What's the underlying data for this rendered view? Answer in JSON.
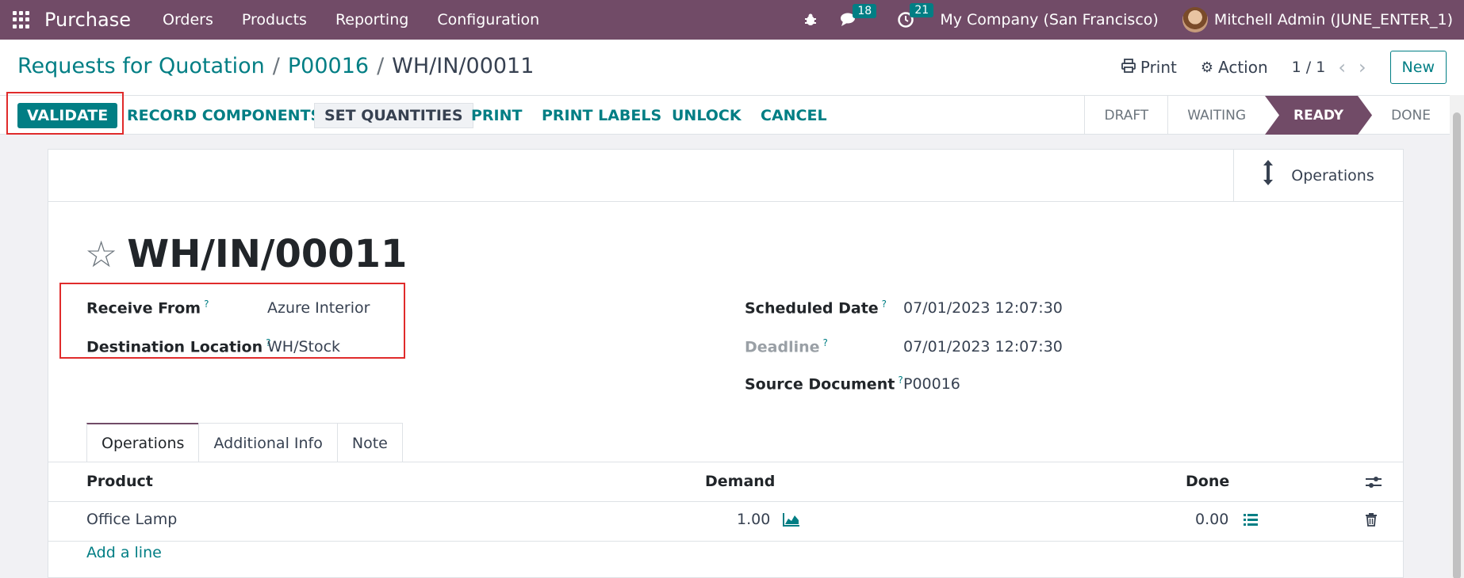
{
  "navbar": {
    "app_name": "Purchase",
    "menu": [
      "Orders",
      "Products",
      "Reporting",
      "Configuration"
    ],
    "messages_count": "18",
    "activities_count": "21",
    "company": "My Company (San Francisco)",
    "user": "Mitchell Admin (JUNE_ENTER_1)"
  },
  "breadcrumb": {
    "root": "Requests for Quotation",
    "parent": "P00016",
    "current": "WH/IN/00011",
    "sep": "/"
  },
  "control": {
    "print_label": "Print",
    "action_label": "Action",
    "pager": "1 / 1",
    "new_label": "New"
  },
  "statusbar": {
    "buttons": [
      "VALIDATE",
      "RECORD COMPONENTS",
      "SET QUANTITIES",
      "PRINT",
      "PRINT LABELS",
      "UNLOCK",
      "CANCEL"
    ],
    "stages": [
      "DRAFT",
      "WAITING",
      "READY",
      "DONE"
    ],
    "active_stage": "READY"
  },
  "form": {
    "smart_button": "Operations",
    "title": "WH/IN/00011",
    "left_fields": [
      {
        "label": "Receive From",
        "value": "Azure Interior"
      },
      {
        "label": "Destination Location",
        "value": "WH/Stock"
      }
    ],
    "right_fields": [
      {
        "label": "Scheduled Date",
        "value": "07/01/2023 12:07:30"
      },
      {
        "label": "Deadline",
        "value": "07/01/2023 12:07:30"
      },
      {
        "label": "Source Document",
        "value": "P00016"
      }
    ],
    "help_mark": "?"
  },
  "tabs": [
    "Operations",
    "Additional Info",
    "Note"
  ],
  "table": {
    "headers": [
      "Product",
      "Demand",
      "Done"
    ],
    "rows": [
      {
        "product": "Office Lamp",
        "demand": "1.00",
        "done": "0.00"
      }
    ],
    "add_line": "Add a line"
  },
  "colors": {
    "brand": "#714b67",
    "accent": "#017e84",
    "highlight": "#e02b2b"
  }
}
